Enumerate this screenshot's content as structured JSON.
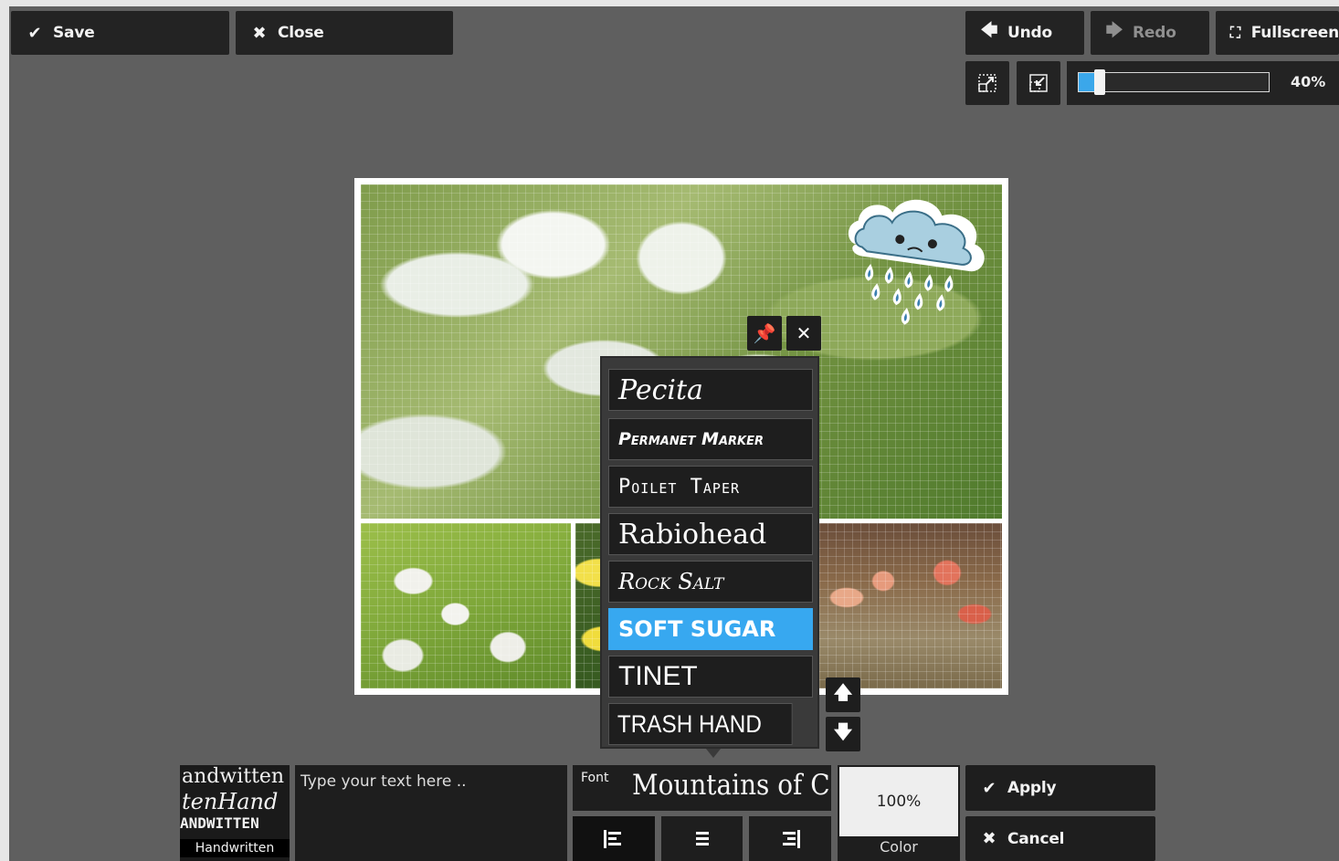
{
  "toolbar": {
    "save_label": "Save",
    "close_label": "Close",
    "undo_label": "Undo",
    "redo_label": "Redo",
    "fullscreen_label": "Fullscreen",
    "zoom_value": "40%",
    "zoom_fraction": 0.08
  },
  "font_list": {
    "items": [
      "Pecita",
      "Permanet Marker",
      "Poilet Taper",
      "Rabiohead",
      "Rock Salt",
      "Soft Sugar",
      "Tinet",
      "Trash Hand"
    ],
    "selected_index": 5
  },
  "text_editor": {
    "preview_lines": [
      "andwitten",
      "tenHand",
      "ANDWITTEN"
    ],
    "preview_label": "Handwritten",
    "input_placeholder": "Type your text here ..",
    "font_label": "Font",
    "font_value": "Mountains of C",
    "color_value": "100%",
    "color_label": "Color",
    "apply_label": "Apply",
    "cancel_label": "Cancel"
  },
  "colors": {
    "accent": "#37a8f0",
    "toolbar_bg": "#232323",
    "stage_bg": "#5f5f5f"
  },
  "icons": [
    "check-icon",
    "x-icon",
    "arrow-left-icon",
    "arrow-right-icon",
    "fullscreen-icon",
    "enlarge-icon",
    "shrink-icon",
    "pin-icon",
    "arrow-up-icon",
    "arrow-down-icon",
    "align-left-icon",
    "align-center-icon",
    "align-right-icon"
  ]
}
